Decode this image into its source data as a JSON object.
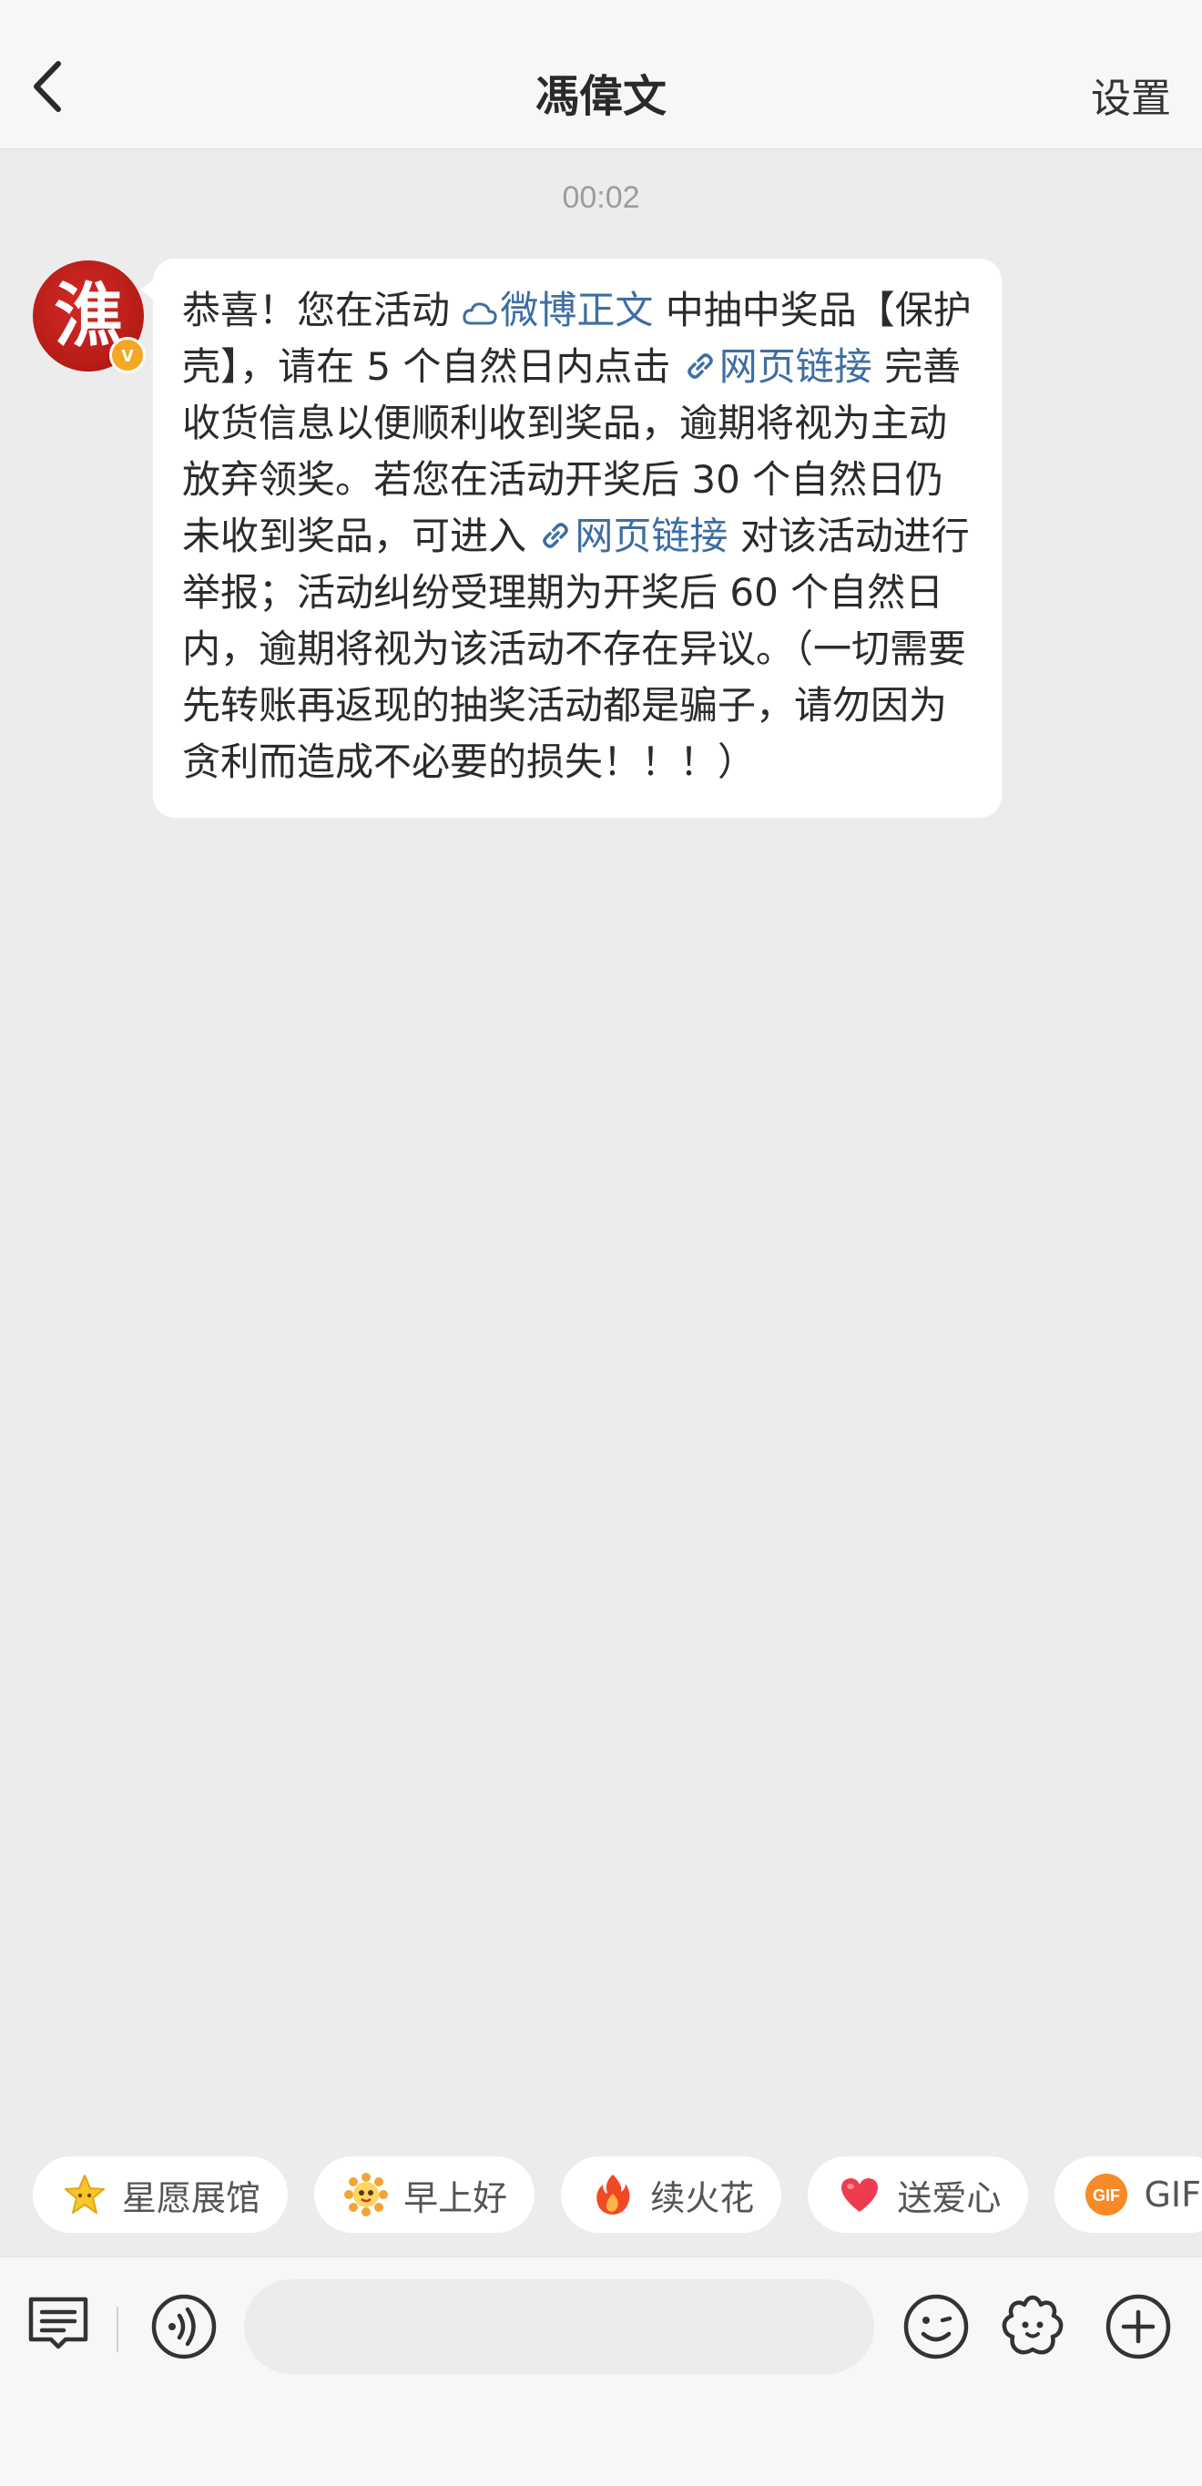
{
  "header": {
    "title": "馮偉文",
    "settings_label": "设置"
  },
  "chat": {
    "timestamp": "00:02",
    "avatar_char": "潐",
    "avatar_badge": "v",
    "message": {
      "t1": "恭喜！您在活动 ",
      "link1": "微博正文",
      "t2": " 中抽中奖品【保护壳】，请在 5 个自然日内点击 ",
      "link2": "网页链接",
      "t3": " 完善收货信息以便顺利收到奖品，逾期将视为主动放弃领奖。若您在活动开奖后 30 个自然日仍未收到奖品，可进入 ",
      "link3": "网页链接",
      "t4": " 对该活动进行举报；活动纠纷受理期为开奖后 60 个自然日内，逾期将视为该活动不存在异议。（一切需要先转账再返现的抽奖活动都是骗子，请勿因为贪利而造成不必要的损失！！！）"
    }
  },
  "quick_replies": [
    {
      "label": "星愿展馆",
      "icon": "star-icon"
    },
    {
      "label": "早上好",
      "icon": "sun-face-icon"
    },
    {
      "label": "续火花",
      "icon": "fire-icon"
    },
    {
      "label": "送爱心",
      "icon": "heart-icon"
    },
    {
      "label": "GIF",
      "icon": "gif-icon"
    }
  ],
  "input": {
    "placeholder": ""
  },
  "colors": {
    "link": "#3d6ea3",
    "background": "#ececec",
    "bubble": "#ffffff"
  }
}
